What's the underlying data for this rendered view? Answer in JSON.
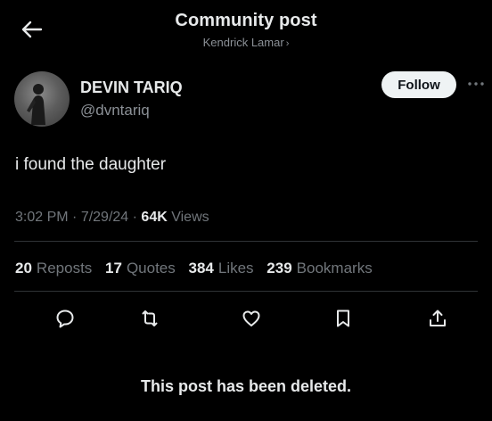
{
  "header": {
    "title": "Community post",
    "subtitle": "Kendrick Lamar",
    "subtitle_chevron": "›"
  },
  "author": {
    "name": "DEVIN TARIQ",
    "handle": "@dvntariq",
    "follow_label": "Follow"
  },
  "post": {
    "text": "i found the daughter",
    "time": "3:02 PM",
    "sep1": " · ",
    "date": "7/29/24",
    "sep2": " · ",
    "views_count": "64K",
    "views_label": "Views"
  },
  "stats": {
    "reposts_count": "20",
    "reposts_label": "Reposts",
    "quotes_count": "17",
    "quotes_label": "Quotes",
    "likes_count": "384",
    "likes_label": "Likes",
    "bookmarks_count": "239",
    "bookmarks_label": "Bookmarks"
  },
  "actions": [
    "reply-icon",
    "repost-icon",
    "like-icon",
    "bookmark-icon",
    "share-icon"
  ],
  "footer": {
    "deleted_notice": "This post has been deleted."
  },
  "colors": {
    "background": "#000000",
    "text_primary": "#e7e9ea",
    "text_secondary": "#71767b",
    "follow_bg": "#eff3f4",
    "follow_text": "#0f1419",
    "divider": "#2f3336"
  }
}
